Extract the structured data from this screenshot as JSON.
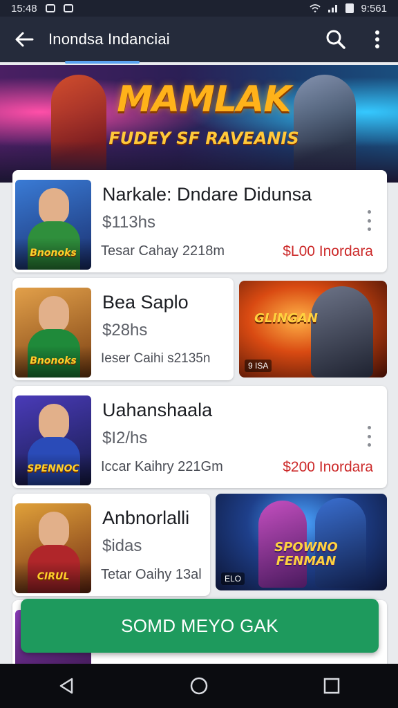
{
  "status_bar": {
    "time_left": "15:48",
    "time_right": "9:561"
  },
  "app_bar": {
    "title": "Inondsa Indanciai"
  },
  "banner": {
    "title": "MAMLAK",
    "subtitle": "FUDEY SF RAVEANIS"
  },
  "items": [
    {
      "title": "Narkale: Dndare Didunsa",
      "price": "$113hs",
      "meta": "Tesar Cahay 2218m",
      "extra": "$L00 Inordara",
      "thumb_logo": "Bnonoks"
    },
    {
      "title": "Bea Saplo",
      "price": "$28hs",
      "meta": "Ieser Caihi s2135n",
      "thumb_logo": "Bnonoks",
      "promo_title": "GLINGAN",
      "promo_tag": "9 ISA"
    },
    {
      "title": "Uahanshaala",
      "price": "$I2/hs",
      "meta": "Iccar Kaihry 221Gm",
      "extra": "$200 Inordara",
      "thumb_logo": "SPENNOC"
    },
    {
      "title": "Anbnorlalli",
      "price": "$idas",
      "meta": "Tetar Oaihy 13al",
      "thumb_logo": "CIRUL",
      "promo_title": "SPOWNO FENMAN",
      "promo_tag": "ELO"
    }
  ],
  "fab": {
    "label": "SOMD MEYO GAK"
  },
  "colors": {
    "accent_green": "#1e9a5d",
    "price_red": "#cc2a2a",
    "app_bar": "#252b3b"
  }
}
